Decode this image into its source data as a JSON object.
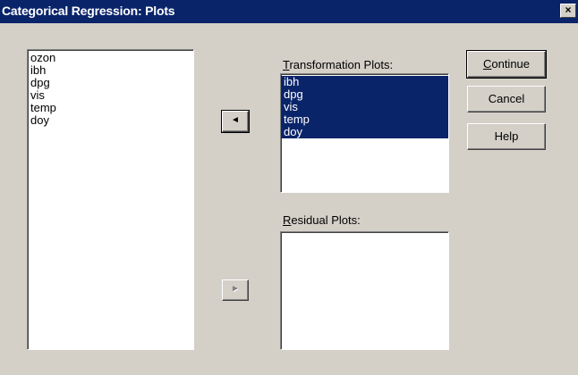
{
  "window": {
    "title": "Categorical Regression: Plots",
    "close_glyph": "×"
  },
  "source_list": {
    "items": [
      "ozon",
      "ibh",
      "dpg",
      "vis",
      "temp",
      "doy"
    ]
  },
  "move_left_button": {
    "glyph": "◄",
    "icon": "arrow-left-icon"
  },
  "move_right_button": {
    "glyph": "►",
    "icon": "arrow-right-icon"
  },
  "transformation_plots": {
    "label_mnemonic": "T",
    "label_rest": "ransformation Plots:",
    "items": [
      "ibh",
      "dpg",
      "vis",
      "temp",
      "doy"
    ]
  },
  "residual_plots": {
    "label_mnemonic": "R",
    "label_rest": "esidual Plots:",
    "items": []
  },
  "buttons": {
    "continue_mnemonic": "C",
    "continue_rest": "ontinue",
    "cancel": "Cancel",
    "help": "Help"
  },
  "colors": {
    "titlebar": "#0a246a",
    "selection": "#0a246a",
    "face": "#d4d0c8"
  }
}
